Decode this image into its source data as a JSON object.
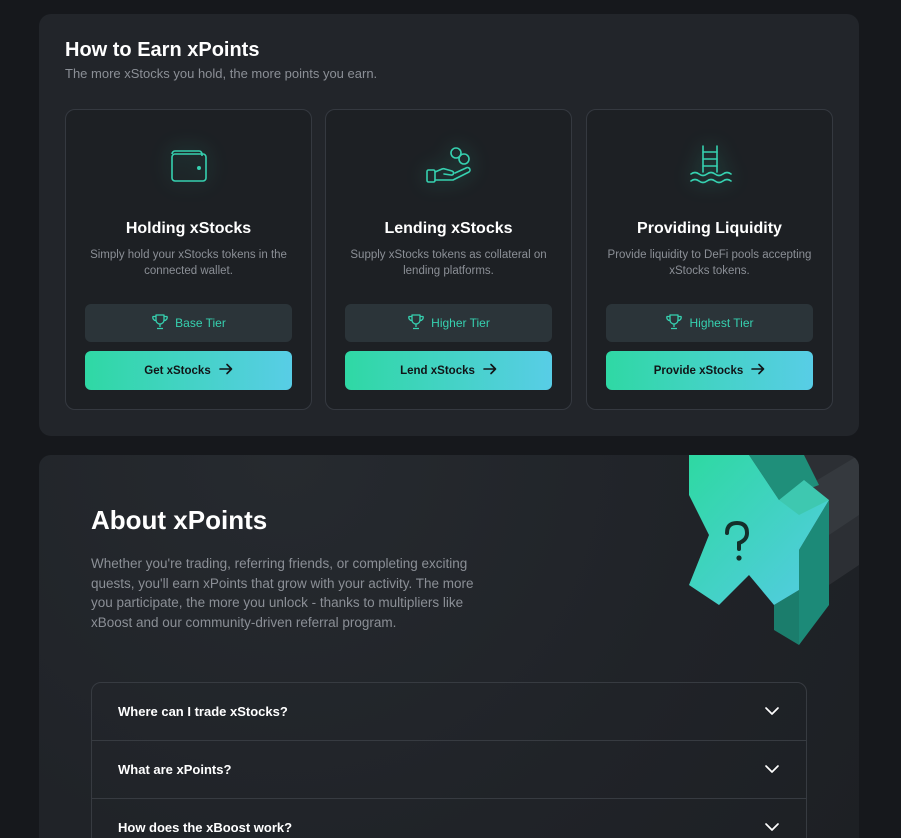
{
  "earn": {
    "title": "How to Earn xPoints",
    "subtitle": "The more xStocks you hold, the more points you earn.",
    "cards": [
      {
        "icon": "wallet-icon",
        "title": "Holding xStocks",
        "description": "Simply hold your xStocks tokens in the connected wallet.",
        "tier": "Base Tier",
        "cta": "Get xStocks"
      },
      {
        "icon": "hand-coins-icon",
        "title": "Lending xStocks",
        "description": "Supply xStocks tokens as collateral on lending platforms.",
        "tier": "Higher Tier",
        "cta": "Lend xStocks"
      },
      {
        "icon": "pool-ladder-icon",
        "title": "Providing Liquidity",
        "description": "Provide liquidity to DeFi pools accepting xStocks tokens.",
        "tier": "Highest Tier",
        "cta": "Provide xStocks"
      }
    ]
  },
  "about": {
    "title": "About xPoints",
    "text": "Whether you're trading, referring friends, or completing exciting quests, you'll earn xPoints that grow with your activity. The more you participate, the more you unlock - thanks to multipliers like xBoost and our community-driven referral program.",
    "faq": [
      {
        "question": "Where can I trade xStocks?"
      },
      {
        "question": "What are xPoints?"
      },
      {
        "question": "How does the xBoost work?"
      }
    ]
  },
  "colors": {
    "accent": "#36d1b0",
    "gradient_start": "#2fd8a4",
    "gradient_end": "#58cde6",
    "background": "#16181c",
    "panel": "#22252a"
  }
}
